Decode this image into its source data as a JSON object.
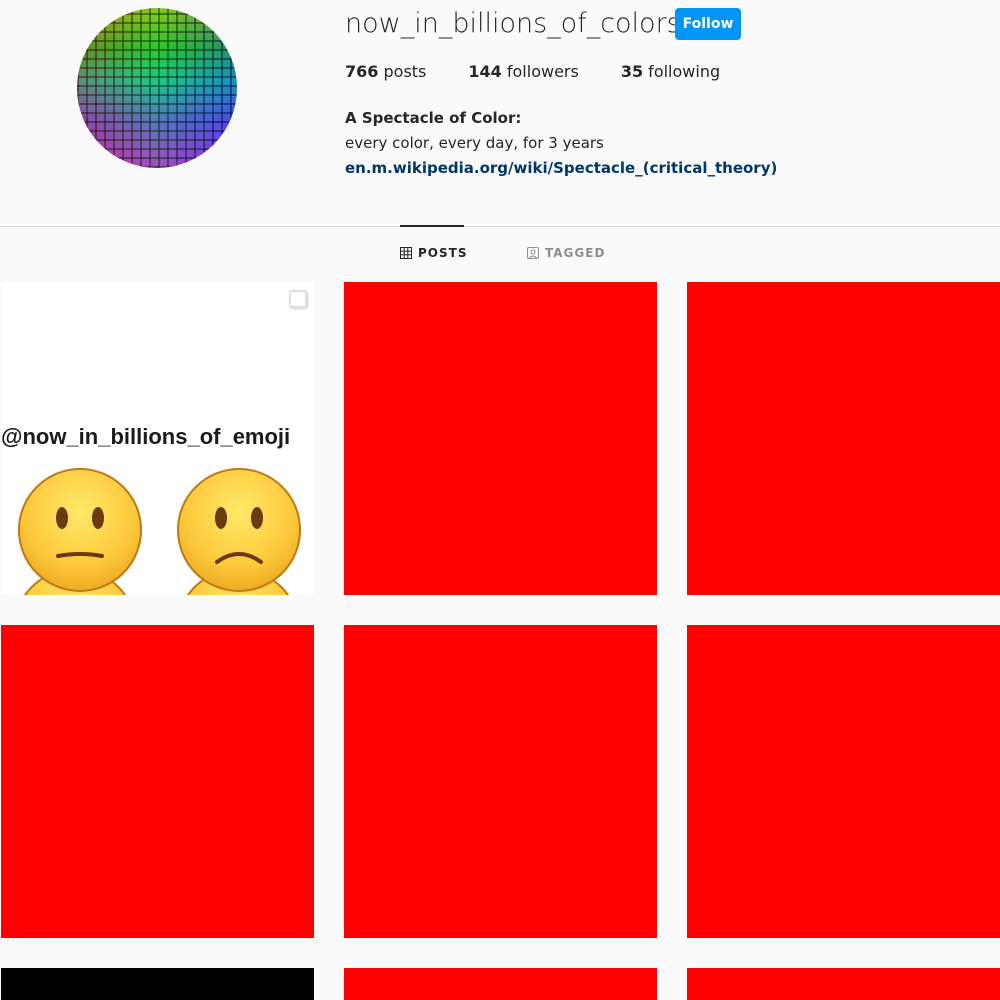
{
  "profile": {
    "username": "now_in_billions_of_colors",
    "follow_label": "Follow",
    "stats": {
      "posts_count": "766",
      "posts_label": " posts",
      "followers_count": "144",
      "followers_label": " followers",
      "following_count": "35",
      "following_label": " following"
    },
    "bio": {
      "title": "A Spectacle of Color:",
      "line": "every color, every day, for 3 years",
      "link": "en.m.wikipedia.org/wiki/Spectacle_(critical_theory)"
    }
  },
  "tabs": [
    {
      "label": "POSTS",
      "icon": "grid-icon",
      "active": true
    },
    {
      "label": "TAGGED",
      "icon": "tagged-icon",
      "active": false
    }
  ],
  "posts": {
    "first_post_caption": "@now_in_billions_of_emoji",
    "colors": {
      "red": "#ff0000",
      "black": "#000000"
    }
  },
  "colors": {
    "accent": "#0095f6",
    "link": "#00376b"
  }
}
